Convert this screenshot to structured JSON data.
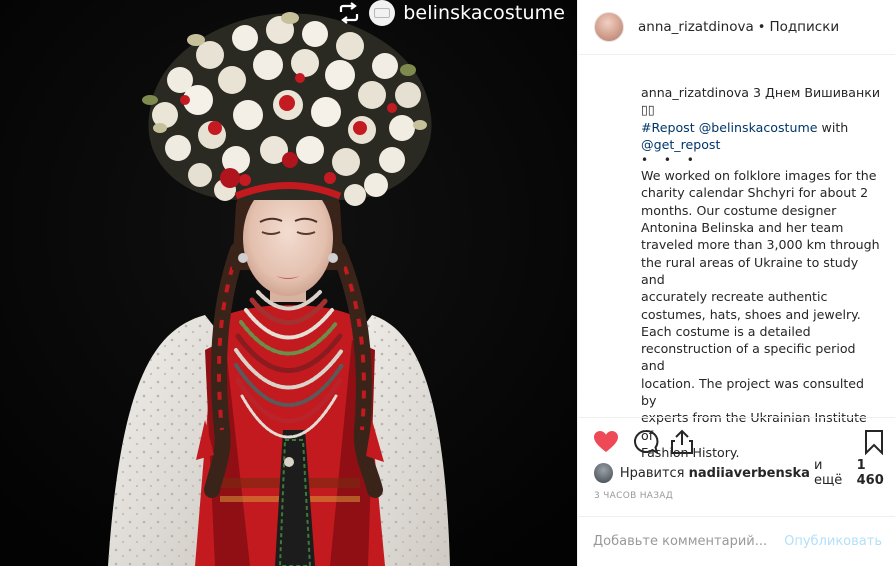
{
  "photo": {
    "repost_account": "belinskacostume",
    "repost_icon": "repost-icon",
    "background_color": "#050505"
  },
  "post": {
    "author": "anna_rizatdinova",
    "separator": "•",
    "follow_label": "Подписки",
    "caption": {
      "greeting": "3 Днем Вишиванки",
      "emoji_placeholder": "▯▯",
      "hashtag": "#Repost",
      "mention_1": "@belinskacostume",
      "with_word": "with",
      "mention_2": "@get_repost",
      "dots": "• • •",
      "lines": [
        "We worked on folklore images for the",
        "charity calendar Shchyri for about 2",
        "months. Our costume designer",
        "Antonina Belinska and her team",
        "traveled more than 3,000 km through",
        "the rural areas of Ukraine to study and",
        "accurately recreate authentic",
        "costumes, hats, shoes and jewelry.",
        "Each costume is a detailed",
        "reconstruction of a specific period and",
        "location. The project was consulted by",
        "experts from the Ukrainian Institute of",
        "Fashion History."
      ]
    },
    "actions": {
      "like_icon": "heart-icon",
      "comment_icon": "comment-icon",
      "share_icon": "share-icon",
      "save_icon": "bookmark-icon",
      "liked": true,
      "like_color": "#ed4956"
    },
    "likes": {
      "prefix": "Нравится",
      "user": "nadiiaverbenska",
      "middle": "и ещё",
      "count": "1 460"
    },
    "timestamp": "3 ЧАСОВ НАЗАД",
    "comment": {
      "placeholder": "Добавьте комментарий...",
      "value": "",
      "publish_label": "Опубликовать",
      "publish_color": "#b2dffc"
    }
  }
}
